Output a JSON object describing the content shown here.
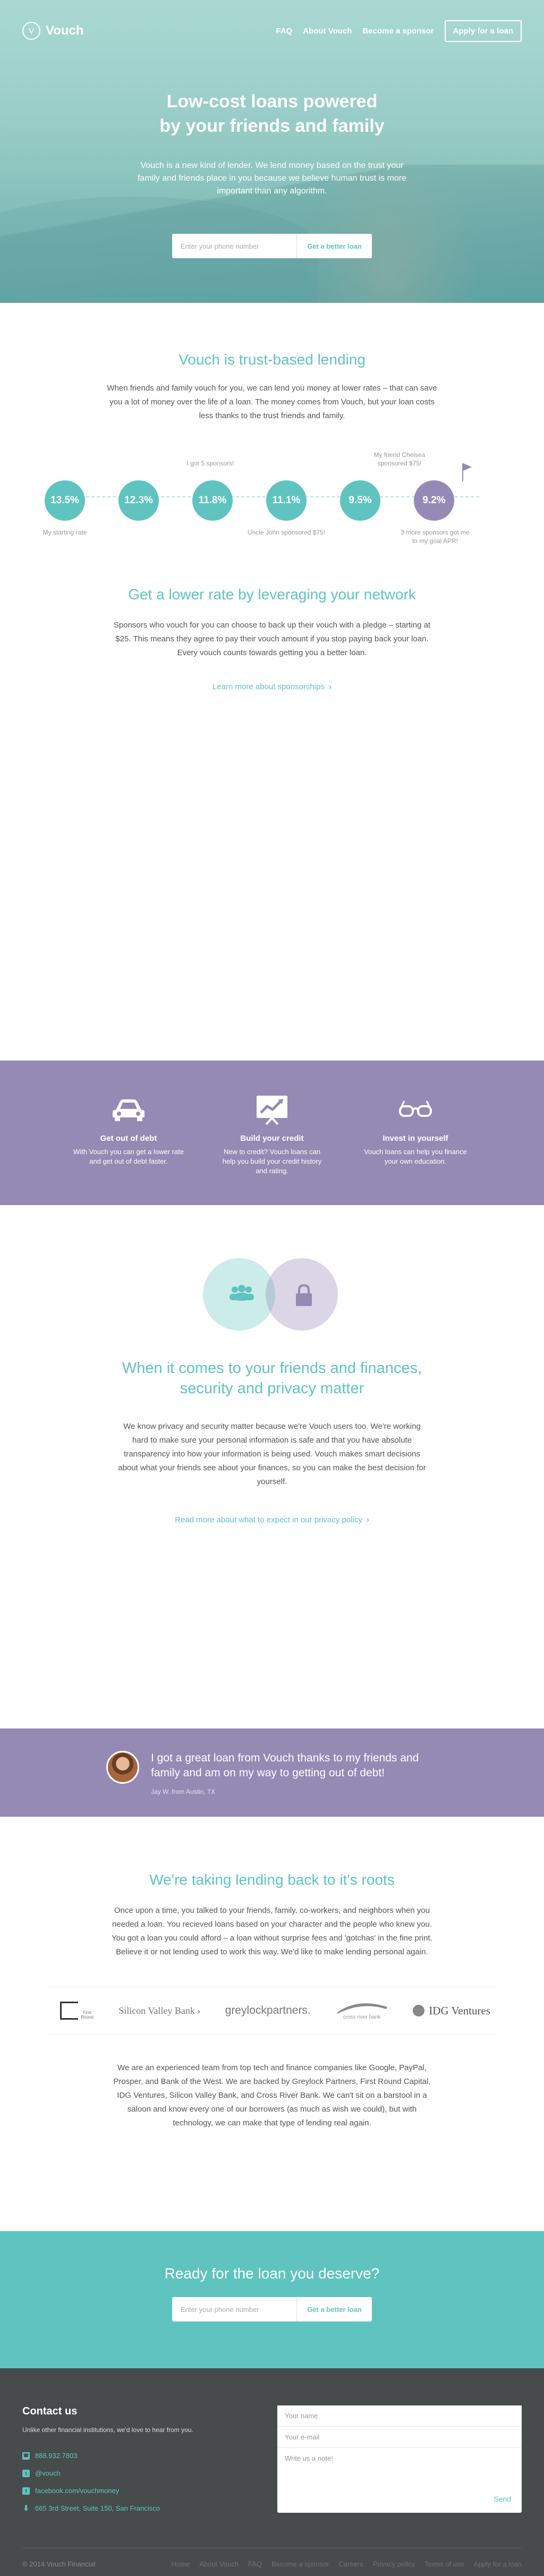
{
  "nav": {
    "brand": "Vouch",
    "brand_icon": "v-ring-logo",
    "links": [
      "FAQ",
      "About Vouch",
      "Become a sponsor"
    ],
    "apply": "Apply for a loan"
  },
  "hero": {
    "title_line1": "Low-cost loans powered",
    "title_line2": "by your friends and family",
    "subtitle": "Vouch is a new kind of lender. We lend money based on the trust your family and friends place in you because we believe human trust is more important than any algorithm.",
    "phone_placeholder": "Enter your phone number",
    "cta": "Get a better loan"
  },
  "trust": {
    "title": "Vouch is trust-based lending",
    "body": "When friends and family vouch for you, we can lend you money at lower rates – that can save you a lot of money over the life of a loan.  The money comes from Vouch, but your loan costs less thanks to the trust friends and family.",
    "rates": [
      "13.5%",
      "12.3%",
      "11.8%",
      "11.1%",
      "9.5%",
      "9.2%"
    ],
    "notes": {
      "start": "My starting rate",
      "sponsors5": "I got 5 sponsors!",
      "uncle": "Uncle John sponsored $75!",
      "chelsea": "My friend Chelsea sponsored $75!",
      "goal": "3 more sponsors got me to my goal APR!"
    }
  },
  "network": {
    "title": "Get a lower rate by leveraging your network",
    "body": "Sponsors who vouch for you can choose to back up their vouch with a pledge – starting at $25. This means they agree to pay their vouch amount if you stop paying back your loan.  Every vouch counts towards getting you a better loan.",
    "link": "Learn more about sponsorships"
  },
  "benefits": [
    {
      "icon": "car-icon",
      "title": "Get out of debt",
      "body": "With Vouch you can get a lower rate and get out of debt faster."
    },
    {
      "icon": "credit-chart-icon",
      "title": "Build your credit",
      "body": "New to credit? Vouch loans can help you build your credit history and rating."
    },
    {
      "icon": "glasses-icon",
      "title": "Invest in yourself",
      "body": "Vouch loans can help you finance your own education."
    }
  ],
  "privacy": {
    "title_line1": "When it comes to your friends and finances,",
    "title_line2": "security and privacy matter",
    "body": "We know privacy and security matter because we're Vouch users too. We're working hard to make sure your personal information is safe and that you have absolute transparency into how your information is being used. Vouch makes smart decisions about what your friends see about your finances, so you can make the best decision for yourself.",
    "link": "Read more about what to expect in our privacy policy"
  },
  "testimonial": {
    "quote": "I got a great loan from Vouch thanks to my friends and family and am on my way to getting out of debt!",
    "by": "Jay W. from Austin, TX"
  },
  "roots": {
    "title": "We're taking lending back to it's roots",
    "body": "Once upon a time, you talked to your friends, family, co-workers, and neighbors when you needed a loan. You recieved loans based on your character and the people who knew you.  You got a loan you could afford – a loan without surprise fees and 'gotchas' in the fine print.  Believe it or not lending used to work this way. We'd like to make lending personal again.",
    "logos": [
      "First Round",
      "Silicon Valley Bank",
      "greylockpartners.",
      "cross river bank",
      "IDG Ventures"
    ],
    "team": "We are an experienced team from top tech and finance companies like Google, PayPal, Prosper, and Bank of the West.  We are backed by Greylock Partners, First Round Capital, IDG Ventures, Silicon Valley Bank, and Cross River Bank.  We can't sit on a barstool in a saloon and know every one of our borrowers (as much as wish we could), but with technology, we can make that type of lending real again."
  },
  "cta": {
    "title": "Ready for the loan you deserve?",
    "phone_placeholder": "Enter your phone number",
    "button": "Get a better loan"
  },
  "footer": {
    "title": "Contact us",
    "intro": "Unlike other financial institutions, we'd love to hear from you.",
    "phone": "888.932.7803",
    "twitter": "@vouch",
    "facebook": "facebook.com/vouchmoney",
    "address": "665 3rd Street, Suite 150, San Francisco",
    "form": {
      "name": "Your name",
      "email": "Your e-mail",
      "note": "Write us a note!",
      "send": "Send"
    },
    "copyright": "© 2014 Vouch Financial",
    "links": [
      "Home",
      "About Vouch",
      "FAQ",
      "Become a sponsor",
      "Careers",
      "Privacy policy",
      "Terms of use",
      "Apply for a loan"
    ]
  },
  "colors": {
    "teal": "#5fc4bf",
    "purple": "#948ab4",
    "footer": "#474b4c"
  }
}
